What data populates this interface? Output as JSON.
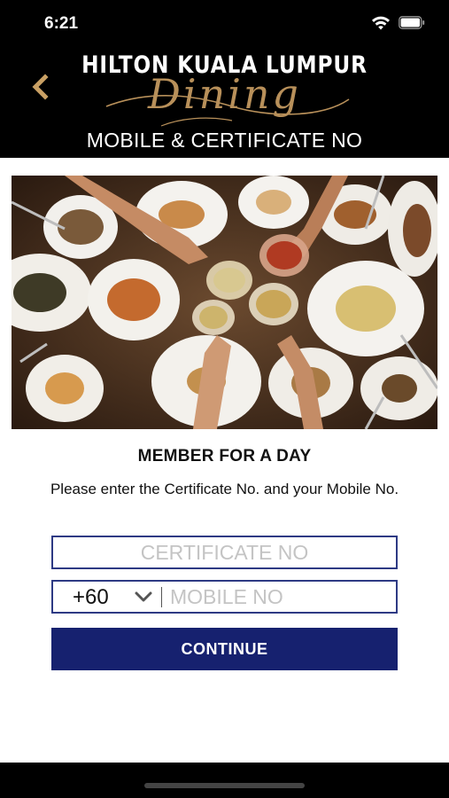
{
  "status_bar": {
    "time": "6:21"
  },
  "header": {
    "brand_name": "HILTON KUALA LUMPUR",
    "brand_script": "Dining",
    "page_title": "MOBILE & CERTIFICATE NO"
  },
  "main": {
    "section_title": "MEMBER FOR A DAY",
    "instructions": "Please enter the Certificate No. and your Mobile No.",
    "certificate_field": {
      "value": "",
      "placeholder": "CERTIFICATE NO"
    },
    "mobile_field": {
      "country_code": "+60",
      "value": "",
      "placeholder": "MOBILE NO"
    },
    "continue_label": "CONTINUE"
  },
  "colors": {
    "header_bg": "#000000",
    "brand_gold": "#b8905a",
    "field_border": "#2e3a84",
    "button_bg": "#16216f"
  },
  "icons": [
    "back-chevron-icon",
    "wifi-icon",
    "battery-icon",
    "chevron-down-icon"
  ]
}
